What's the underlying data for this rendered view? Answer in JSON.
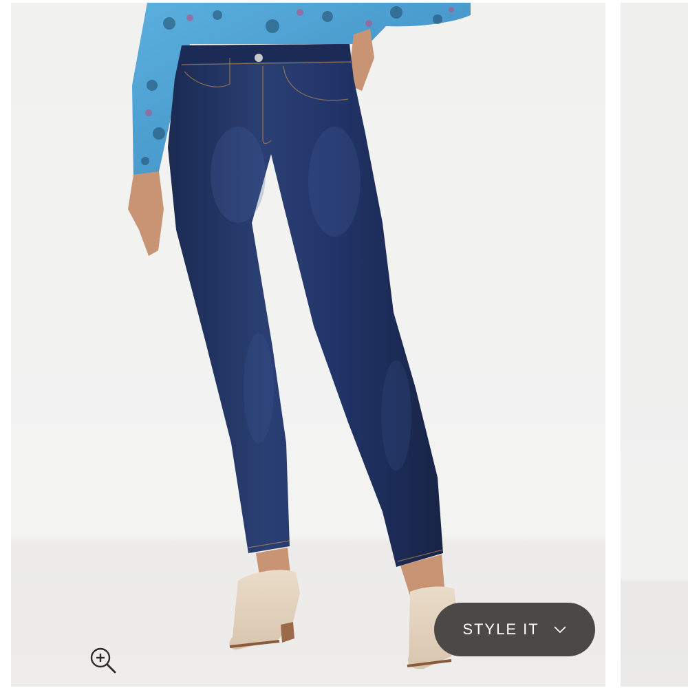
{
  "gallery": {
    "style_it_label": "STYLE IT",
    "zoom_icon": "zoom-in-icon",
    "chevron_icon": "chevron-down-icon"
  },
  "colors": {
    "button_bg": "#4a4948",
    "denim": "#1f3263",
    "shirt": "#4a9fd2",
    "boots": "#e3d3c0"
  }
}
